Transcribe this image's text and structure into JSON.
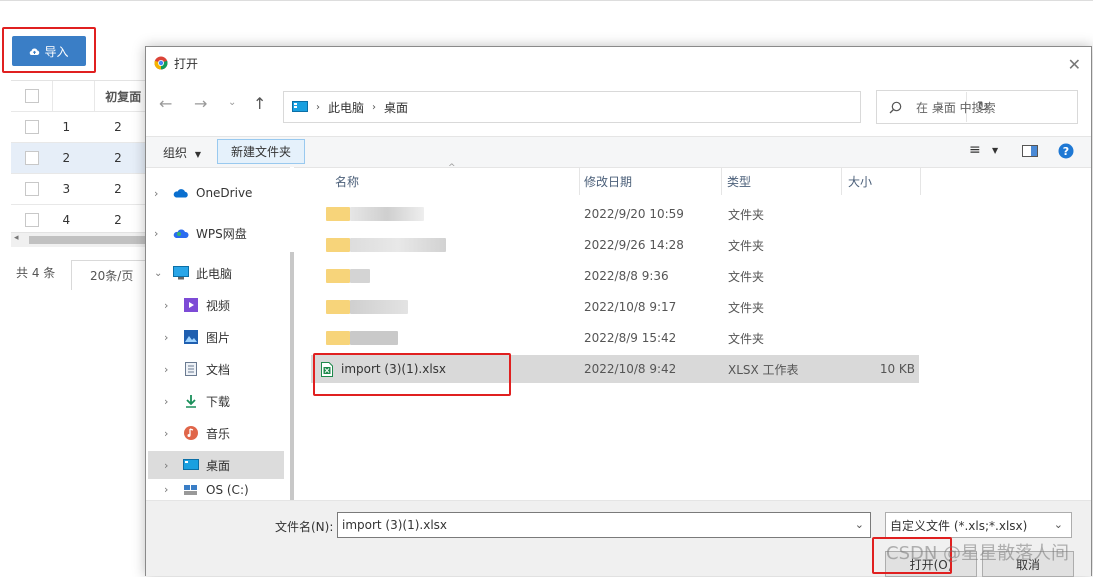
{
  "page": {
    "import_button": "导入",
    "table": {
      "header": "初复面",
      "rows": [
        {
          "index": "1",
          "value": "2"
        },
        {
          "index": "2",
          "value": "2"
        },
        {
          "index": "3",
          "value": "2"
        },
        {
          "index": "4",
          "value": "2"
        }
      ]
    },
    "total": "共 4 条",
    "page_size": "20条/页"
  },
  "dialog": {
    "title": "打开",
    "breadcrumb": [
      "此电脑",
      "桌面"
    ],
    "search_placeholder": "在 桌面 中搜索",
    "toolbar": {
      "organize": "组织",
      "new_folder": "新建文件夹"
    },
    "nav_items": [
      {
        "label": "OneDrive",
        "icon": "cloud-icon"
      },
      {
        "label": "WPS网盘",
        "icon": "wps-cloud-icon"
      },
      {
        "label": "此电脑",
        "icon": "computer-icon"
      },
      {
        "label": "视频",
        "icon": "video-icon"
      },
      {
        "label": "图片",
        "icon": "picture-icon"
      },
      {
        "label": "文档",
        "icon": "document-icon"
      },
      {
        "label": "下载",
        "icon": "download-icon"
      },
      {
        "label": "音乐",
        "icon": "music-icon"
      },
      {
        "label": "桌面",
        "icon": "desktop-icon"
      },
      {
        "label": "OS (C:)",
        "icon": "drive-icon"
      }
    ],
    "columns": {
      "name": "名称",
      "date": "修改日期",
      "type": "类型",
      "size": "大小"
    },
    "files": [
      {
        "name": "",
        "date": "2022/9/20 10:59",
        "type": "文件夹",
        "size": ""
      },
      {
        "name": "",
        "date": "2022/9/26 14:28",
        "type": "文件夹",
        "size": ""
      },
      {
        "name": "",
        "date": "2022/8/8 9:36",
        "type": "文件夹",
        "size": ""
      },
      {
        "name": "",
        "date": "2022/10/8 9:17",
        "type": "文件夹",
        "size": ""
      },
      {
        "name": "",
        "date": "2022/8/9 15:42",
        "type": "文件夹",
        "size": ""
      },
      {
        "name": "import (3)(1).xlsx",
        "date": "2022/10/8 9:42",
        "type": "XLSX 工作表",
        "size": "10 KB"
      }
    ],
    "filename_label": "文件名(N):",
    "filename_value": "import (3)(1).xlsx",
    "filter_value": "自定义文件 (*.xls;*.xlsx)",
    "open_button": "打开(O)",
    "cancel_button": "取消"
  },
  "watermark": "CSDN @星星散落人间",
  "colors": {
    "accent": "#3a7ec6",
    "highlight_box": "#e02020",
    "selection": "#d9d9d9"
  }
}
